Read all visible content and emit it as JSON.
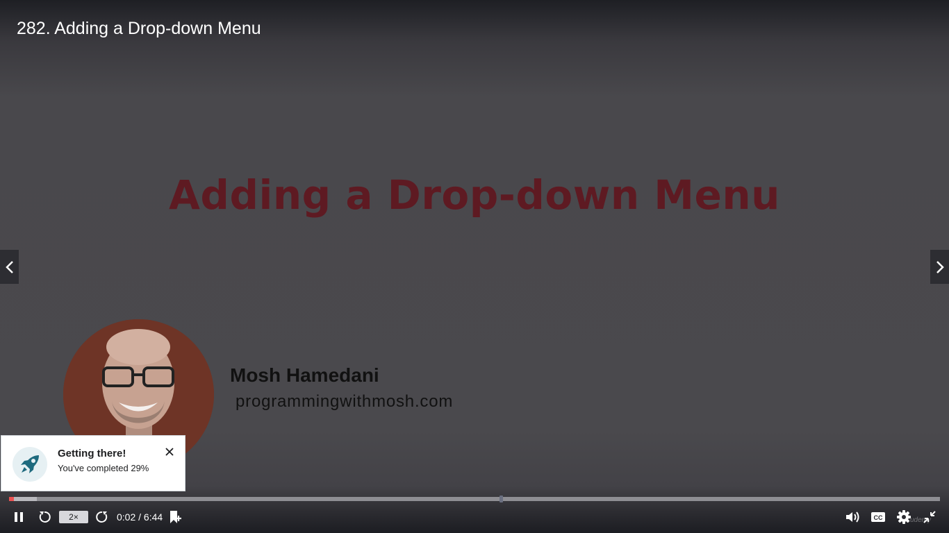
{
  "lecture": {
    "title": "282. Adding a Drop-down Menu"
  },
  "slide": {
    "title": "Adding a Drop-down Menu",
    "presenter_name": "Mosh Hamedani",
    "presenter_site": "programmingwithmosh.com"
  },
  "toast": {
    "title": "Getting there!",
    "message": "You've completed 29%"
  },
  "player": {
    "speed_label": "2×",
    "current_time": "0:02",
    "duration": "6:44",
    "time_separator": " / ",
    "played_fraction": 0.005,
    "buffered_fraction": 0.03,
    "marker_fraction": 0.528,
    "watermark": "udemy"
  },
  "icons": {
    "prev": "chevron-left-icon",
    "next": "chevron-right-icon",
    "toast": "rocket-icon",
    "close": "close-icon",
    "pause": "pause-icon",
    "rewind": "rewind-5-icon",
    "forward": "forward-5-icon",
    "bookmark": "add-bookmark-icon",
    "volume": "volume-icon",
    "captions": "closed-captions-icon",
    "settings": "gear-icon",
    "fullscreen": "exit-fullscreen-icon"
  },
  "colors": {
    "progress_played": "#ec5252",
    "slide_title": "#5e1a22",
    "toast_icon": "#1e6a7e"
  }
}
